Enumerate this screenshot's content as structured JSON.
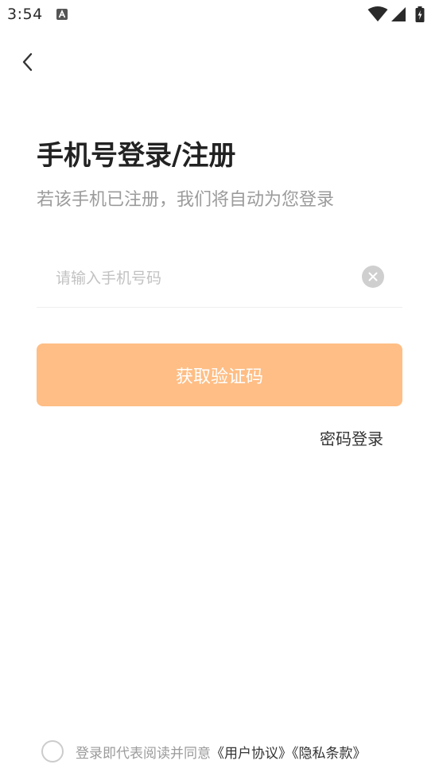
{
  "status_bar": {
    "time": "3:54",
    "icons": [
      "app-notification-icon",
      "wifi-icon",
      "signal-icon",
      "battery-icon"
    ]
  },
  "nav": {
    "back_icon": "chevron-left-icon"
  },
  "login": {
    "title": "手机号登录/注册",
    "subtitle": "若该手机已注册，我们将自动为您登录",
    "phone_input": {
      "value": "",
      "placeholder": "请输入手机号码",
      "clear_icon": "clear-circle-icon"
    },
    "get_code_button": "获取验证码",
    "password_login_link": "密码登录"
  },
  "agreement": {
    "prefix": "登录即代表阅读并同意",
    "user_agreement": "《用户协议》",
    "privacy_policy": "《隐私条款》"
  },
  "colors": {
    "primary_button": "#ffbe85",
    "button_text": "#ffffff",
    "title_text": "#222222",
    "secondary_text": "#9b9b9b",
    "placeholder_text": "#c2c2c2"
  }
}
